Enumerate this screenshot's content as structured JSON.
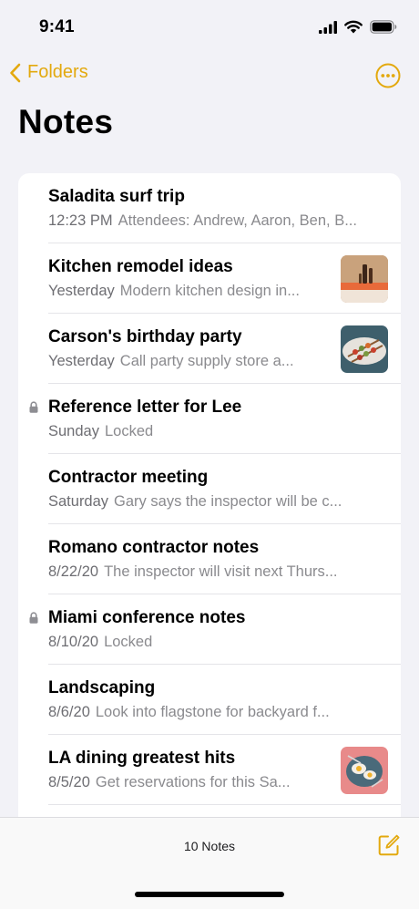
{
  "status_bar": {
    "time": "9:41"
  },
  "nav": {
    "back_label": "Folders"
  },
  "page": {
    "title": "Notes"
  },
  "notes": [
    {
      "title": "Saladita surf trip",
      "date": "12:23 PM",
      "preview": "Attendees: Andrew, Aaron, Ben, B...",
      "locked": false,
      "thumbnail": null
    },
    {
      "title": "Kitchen remodel ideas",
      "date": "Yesterday",
      "preview": "Modern kitchen design in...",
      "locked": false,
      "thumbnail": "kitchen-photo"
    },
    {
      "title": "Carson's birthday party",
      "date": "Yesterday",
      "preview": "Call party supply store a...",
      "locked": false,
      "thumbnail": "skewers-photo"
    },
    {
      "title": "Reference letter for Lee",
      "date": "Sunday",
      "preview": "Locked",
      "locked": true,
      "thumbnail": null
    },
    {
      "title": "Contractor meeting",
      "date": "Saturday",
      "preview": "Gary says the inspector will be c...",
      "locked": false,
      "thumbnail": null
    },
    {
      "title": "Romano contractor notes",
      "date": "8/22/20",
      "preview": "The inspector will visit next Thurs...",
      "locked": false,
      "thumbnail": null
    },
    {
      "title": "Miami conference notes",
      "date": "8/10/20",
      "preview": "Locked",
      "locked": true,
      "thumbnail": null
    },
    {
      "title": "Landscaping",
      "date": "8/6/20",
      "preview": "Look into flagstone for backyard f...",
      "locked": false,
      "thumbnail": null
    },
    {
      "title": "LA dining greatest hits",
      "date": "8/5/20",
      "preview": "Get reservations for this Sa...",
      "locked": false,
      "thumbnail": "food-photo"
    }
  ],
  "toolbar": {
    "count_label": "10 Notes"
  },
  "colors": {
    "accent": "#e3a90e",
    "background": "#f2f2f7",
    "secondary_text": "#8a8a8e"
  }
}
